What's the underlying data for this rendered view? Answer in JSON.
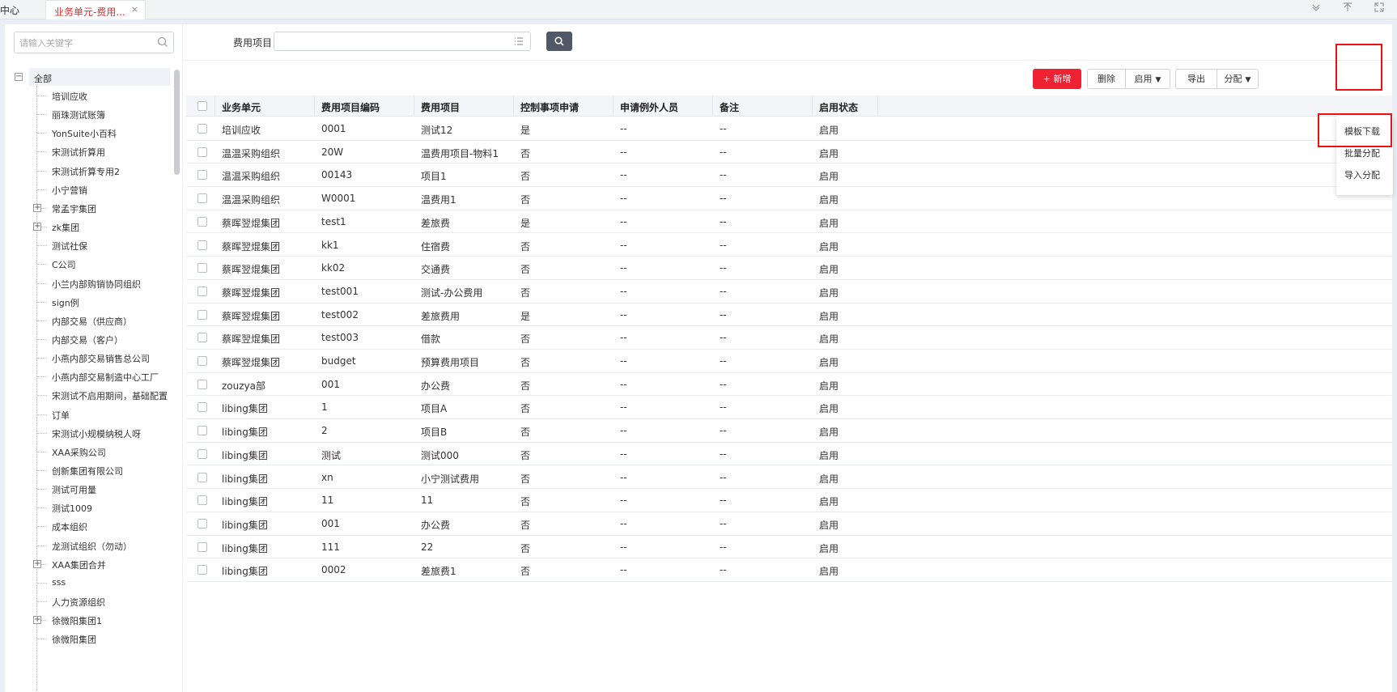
{
  "topbar": {
    "crumb": "中心",
    "tab_label": "业务单元-费用...",
    "tab_close": "×"
  },
  "tree": {
    "search_placeholder": "请输入关键字",
    "root": "全部",
    "nodes": [
      {
        "label": "培训应收",
        "expandable": false
      },
      {
        "label": "丽珠测试账簿",
        "expandable": false
      },
      {
        "label": "YonSuite小百科",
        "expandable": false
      },
      {
        "label": "宋测试折算用",
        "expandable": false
      },
      {
        "label": "宋测试折算专用2",
        "expandable": false
      },
      {
        "label": "小宁营销",
        "expandable": false
      },
      {
        "label": "常孟宇集团",
        "expandable": true
      },
      {
        "label": "zk集团",
        "expandable": true
      },
      {
        "label": "测试社保",
        "expandable": false
      },
      {
        "label": "C公司",
        "expandable": false
      },
      {
        "label": "小兰内部购销协同组织",
        "expandable": false
      },
      {
        "label": "sign例",
        "expandable": false
      },
      {
        "label": "内部交易（供应商）",
        "expandable": false
      },
      {
        "label": "内部交易（客户）",
        "expandable": false
      },
      {
        "label": "小燕内部交易销售总公司",
        "expandable": false
      },
      {
        "label": "小燕内部交易制造中心工厂",
        "expandable": false
      },
      {
        "label": "宋测试不启用期间，基础配置",
        "expandable": false
      },
      {
        "label": "订单",
        "expandable": false
      },
      {
        "label": "宋测试小规模纳税人呀",
        "expandable": false
      },
      {
        "label": "XAA采购公司",
        "expandable": false
      },
      {
        "label": "创新集团有限公司",
        "expandable": false
      },
      {
        "label": "测试可用量",
        "expandable": false
      },
      {
        "label": "测试1009",
        "expandable": false
      },
      {
        "label": "成本组织",
        "expandable": false
      },
      {
        "label": "龙测试组织（勿动）",
        "expandable": false
      },
      {
        "label": "XAA集团合并",
        "expandable": true
      },
      {
        "label": "sss",
        "expandable": false
      },
      {
        "label": "人力资源组织",
        "expandable": false
      },
      {
        "label": "徐微阳集团1",
        "expandable": true
      },
      {
        "label": "徐微阳集团",
        "expandable": false
      }
    ]
  },
  "filter": {
    "label": "费用项目",
    "value": ""
  },
  "toolbar": {
    "add": "+ 新增",
    "delete": "删除",
    "enable": "启用",
    "export": "导出",
    "assign": "分配"
  },
  "table": {
    "headers": [
      "业务单元",
      "费用项目编码",
      "费用项目",
      "控制事项申请",
      "申请例外人员",
      "备注",
      "启用状态"
    ],
    "rows": [
      [
        "培训应收",
        "0001",
        "测试12",
        "是",
        "--",
        "--",
        "启用"
      ],
      [
        "温温采购组织",
        "20W",
        "温费用项目-物料1",
        "否",
        "--",
        "--",
        "启用"
      ],
      [
        "温温采购组织",
        "00143",
        "项目1",
        "否",
        "--",
        "--",
        "启用"
      ],
      [
        "温温采购组织",
        "W0001",
        "温费用1",
        "否",
        "--",
        "--",
        "启用"
      ],
      [
        "蔡晖翌焜集团",
        "test1",
        "差旅费",
        "是",
        "--",
        "--",
        "启用"
      ],
      [
        "蔡晖翌焜集团",
        "kk1",
        "住宿费",
        "否",
        "--",
        "--",
        "启用"
      ],
      [
        "蔡晖翌焜集团",
        "kk02",
        "交通费",
        "否",
        "--",
        "--",
        "启用"
      ],
      [
        "蔡晖翌焜集团",
        "test001",
        "测试-办公费用",
        "否",
        "--",
        "--",
        "启用"
      ],
      [
        "蔡晖翌焜集团",
        "test002",
        "差旅费用",
        "是",
        "--",
        "--",
        "启用"
      ],
      [
        "蔡晖翌焜集团",
        "test003",
        "借款",
        "否",
        "--",
        "--",
        "启用"
      ],
      [
        "蔡晖翌焜集团",
        "budget",
        "预算费用项目",
        "否",
        "--",
        "--",
        "启用"
      ],
      [
        "zouzya部",
        "001",
        "办公费",
        "否",
        "--",
        "--",
        "启用"
      ],
      [
        "libing集团",
        "1",
        "项目A",
        "否",
        "--",
        "--",
        "启用"
      ],
      [
        "libing集团",
        "2",
        "项目B",
        "否",
        "--",
        "--",
        "启用"
      ],
      [
        "libing集团",
        "测试",
        "测试000",
        "否",
        "--",
        "--",
        "启用"
      ],
      [
        "libing集团",
        "xn",
        "小宁测试费用",
        "否",
        "--",
        "--",
        "启用"
      ],
      [
        "libing集团",
        "11",
        "11",
        "否",
        "--",
        "--",
        "启用"
      ],
      [
        "libing集团",
        "001",
        "办公费",
        "否",
        "--",
        "--",
        "启用"
      ],
      [
        "libing集团",
        "111",
        "22",
        "否",
        "--",
        "--",
        "启用"
      ],
      [
        "libing集团",
        "0002",
        "差旅费1",
        "否",
        "--",
        "--",
        "启用"
      ]
    ]
  },
  "assign_menu": {
    "items": [
      "模板下载",
      "批量分配",
      "导入分配"
    ]
  },
  "colors": {
    "accent": "#ee2233",
    "highlight_box": "#ee1111"
  }
}
